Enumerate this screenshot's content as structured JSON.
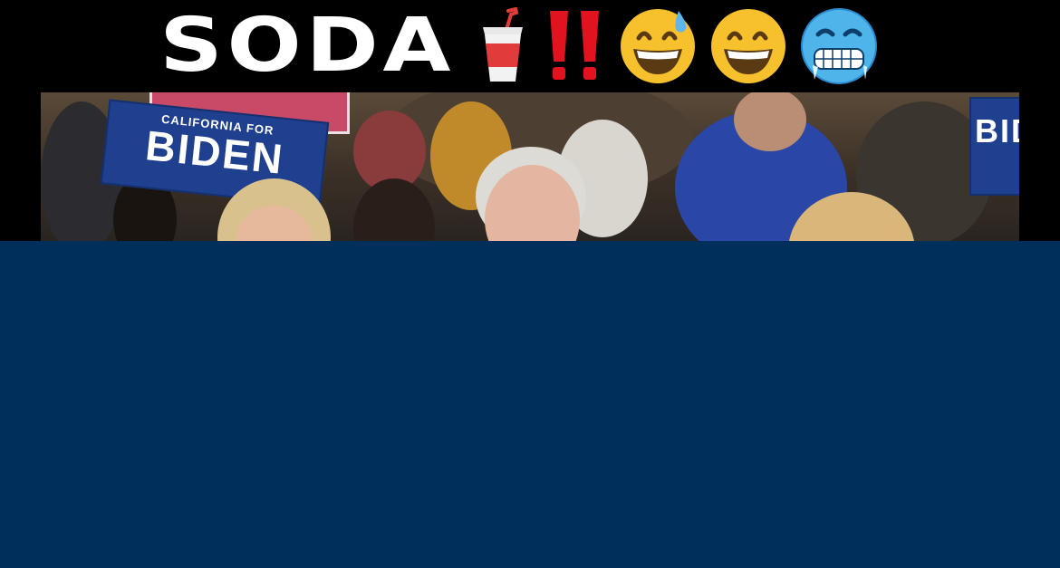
{
  "video": {
    "caption": "SODA",
    "caption_icons": [
      "cup-with-straw-icon",
      "double-exclamation-icon",
      "grinning-sweat-face-icon",
      "grinning-face-icon",
      "cold-face-icon"
    ],
    "signs": {
      "left_small": "CALIFORNIA FOR",
      "left_big": "BIDEN",
      "right_big": "BID"
    }
  },
  "colors": {
    "background": "#002f5c",
    "caption_bar": "#000000",
    "sign_blue": "#1f3f8f"
  }
}
